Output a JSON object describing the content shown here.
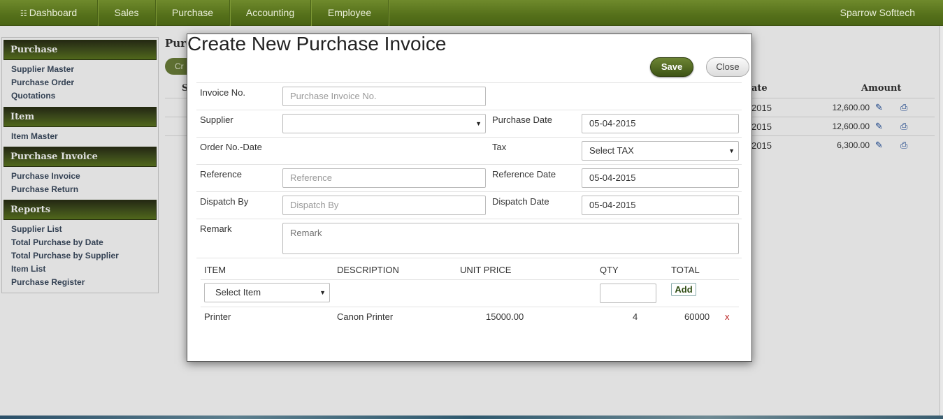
{
  "nav": {
    "items": [
      {
        "label": "Dashboard"
      },
      {
        "label": "Sales"
      },
      {
        "label": "Purchase"
      },
      {
        "label": "Accounting"
      },
      {
        "label": "Employee"
      }
    ],
    "brand": "Sparrow Softtech"
  },
  "sidebar": {
    "sections": [
      {
        "title": "Purchase",
        "links": [
          "Supplier Master",
          "Purchase Order",
          "Quotations"
        ]
      },
      {
        "title": "Item",
        "links": [
          "Item Master"
        ]
      },
      {
        "title": "Purchase Invoice",
        "links": [
          "Purchase Invoice",
          "Purchase Return"
        ]
      },
      {
        "title": "Reports",
        "links": [
          "Supplier List",
          "Total Purchase by Date",
          "Total Purchase by Supplier",
          "Item List",
          "Purchase Register"
        ]
      }
    ]
  },
  "background": {
    "page_title_partial": "Purc",
    "create_button_partial": "Cr",
    "table_headers": {
      "first_partial": "S",
      "date_partial": "ate",
      "amount": "Amount"
    },
    "rows": [
      {
        "year": "2015",
        "amount": "12,600.00"
      },
      {
        "year": "2015",
        "amount": "12,600.00"
      },
      {
        "year": "2015",
        "amount": "6,300.00"
      }
    ]
  },
  "modal": {
    "title": "Create New Purchase Invoice",
    "save_label": "Save",
    "close_label": "Close",
    "fields": {
      "invoice_no_label": "Invoice No.",
      "invoice_no_placeholder": "Purchase Invoice No.",
      "supplier_label": "Supplier",
      "supplier_value": "",
      "purchase_date_label": "Purchase Date",
      "purchase_date_value": "05-04-2015",
      "order_no_label": "Order No.-Date",
      "tax_label": "Tax",
      "tax_value": "Select TAX",
      "reference_label": "Reference",
      "reference_placeholder": "Reference",
      "reference_date_label": "Reference Date",
      "reference_date_value": "05-04-2015",
      "dispatch_by_label": "Dispatch By",
      "dispatch_by_placeholder": "Dispatch By",
      "dispatch_date_label": "Dispatch Date",
      "dispatch_date_value": "05-04-2015",
      "remark_label": "Remark",
      "remark_placeholder": "Remark"
    },
    "items_table": {
      "headers": [
        "ITEM",
        "DESCRIPTION",
        "UNIT PRICE",
        "QTY",
        "TOTAL"
      ],
      "select_item_value": "Select Item",
      "qty_value": "",
      "add_label": "Add",
      "rows": [
        {
          "item": "Printer",
          "description": "Canon Printer",
          "unit_price": "15000.00",
          "qty": "4",
          "total": "60000",
          "remove": "x"
        }
      ]
    }
  }
}
